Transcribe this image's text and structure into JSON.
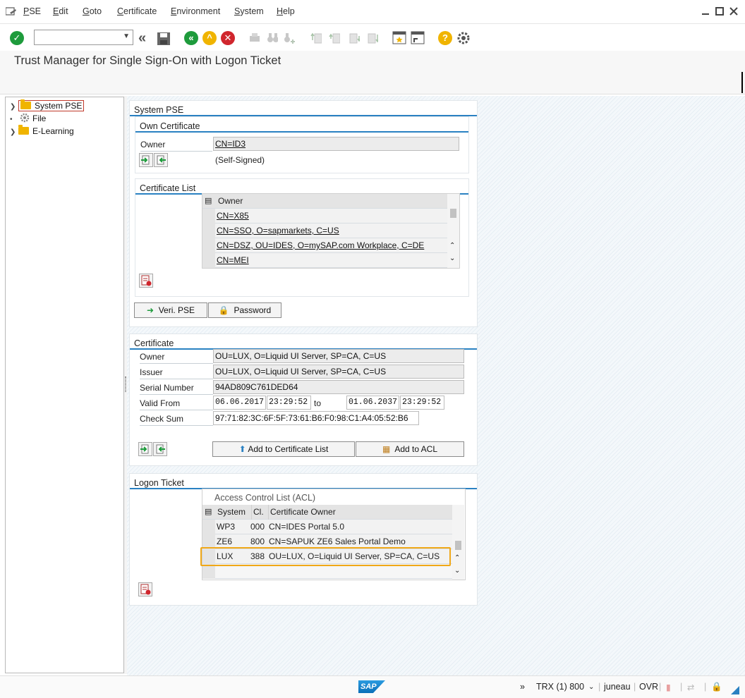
{
  "menubar": {
    "items": [
      "PSE",
      "Edit",
      "Goto",
      "Certificate",
      "Environment",
      "System",
      "Help"
    ]
  },
  "toolbar": {
    "command_value": "",
    "icons": [
      "enter-icon",
      "back-icon",
      "save-icon",
      "back-green-icon",
      "exit-icon",
      "cancel-icon",
      "print-icon",
      "find-icon",
      "find-next-icon",
      "first-page-icon",
      "prev-page-icon",
      "next-page-icon",
      "last-page-icon",
      "create-session-icon",
      "shortcut-icon",
      "help-icon",
      "settings-icon"
    ],
    "colors": {
      "enter": "#1e9b3c",
      "back": "#1e9b3c",
      "exit": "#f0b400",
      "cancel": "#d0262d",
      "help": "#f0b400"
    }
  },
  "title": "Trust Manager for Single Sign-On with Logon Ticket",
  "tree": {
    "items": [
      {
        "label": "System PSE",
        "icon": "folder-icon"
      },
      {
        "label": "File",
        "icon": "gear-icon"
      },
      {
        "label": "E-Learning",
        "icon": "folder-icon"
      }
    ]
  },
  "system_pse": {
    "title": "System PSE",
    "own_certificate": {
      "title": "Own Certificate",
      "owner_label": "Owner",
      "owner_value": "CN=ID3",
      "self_signed": "(Self-Signed)"
    },
    "certificate_list": {
      "title": "Certificate List",
      "column": "Owner",
      "rows": [
        "CN=X85",
        "CN=SSO, O=sapmarkets, C=US",
        "CN=DSZ, OU=IDES, O=mySAP.com Workplace, C=DE",
        "CN=MEI"
      ]
    },
    "veri_pse_label": "Veri. PSE",
    "password_label": "Password"
  },
  "certificate": {
    "title": "Certificate",
    "owner_label": "Owner",
    "owner_value": "OU=LUX, O=Liquid UI Server, SP=CA, C=US",
    "issuer_label": "Issuer",
    "issuer_value": "OU=LUX, O=Liquid UI Server, SP=CA, C=US",
    "serial_label": "Serial Number",
    "serial_value": "94AD809C761DED64",
    "valid_from_label": "Valid From",
    "valid_from_date": "06.06.2017",
    "valid_from_time": "23:29:52",
    "to_label": "to",
    "valid_to_date": "01.06.2037",
    "valid_to_time": "23:29:52",
    "checksum_label": "Check Sum",
    "checksum_value": "97:71:82:3C:6F:5F:73:61:B6:F0:98:C1:A4:05:52:B6",
    "add_cert_label": "Add to Certificate List",
    "add_acl_label": "Add to ACL"
  },
  "logon_ticket": {
    "title": "Logon Ticket",
    "acl_title": "Access Control List (ACL)",
    "columns": [
      "System",
      "Cl.",
      "Certificate Owner"
    ],
    "rows": [
      {
        "system": "WP3",
        "client": "000",
        "owner": "CN=IDES Portal 5.0"
      },
      {
        "system": "ZE6",
        "client": "800",
        "owner": "CN=SAPUK ZE6 Sales Portal Demo"
      },
      {
        "system": "LUX",
        "client": "388",
        "owner": "OU=LUX, O=Liquid UI Server, SP=CA, C=US"
      }
    ],
    "highlight_color": "#f0a818"
  },
  "statusbar": {
    "logo": "SAP",
    "session": "TRX (1) 800",
    "server": "juneau",
    "mode": "OVR"
  }
}
